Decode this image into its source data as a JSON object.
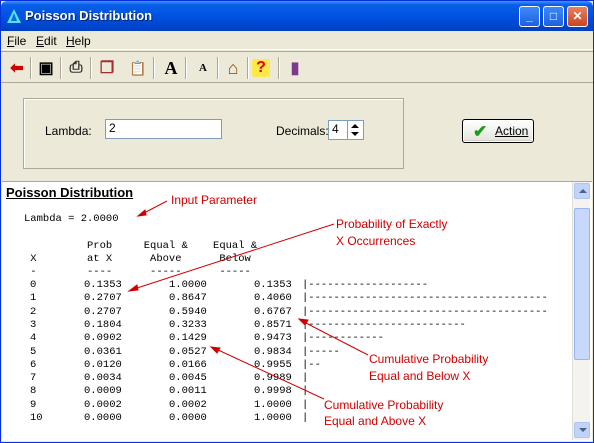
{
  "window": {
    "title": "Poisson Distribution",
    "minimize": "_",
    "maximize": "□",
    "close": "✕"
  },
  "menu": [
    {
      "label": "File",
      "accel": "F",
      "rest": "ile"
    },
    {
      "label": "Edit",
      "accel": "E",
      "rest": "dit"
    },
    {
      "label": "Help",
      "accel": "H",
      "rest": "elp"
    }
  ],
  "toolbar": {
    "buttons": [
      "back-icon",
      "save-icon",
      "print-icon",
      "copy-icon",
      "paste-icon",
      "font-larger-icon",
      "font-smaller-icon",
      "home-icon",
      "help-icon",
      "exit-icon"
    ],
    "glyphs": {
      "back": "⬅",
      "save": "▣",
      "print": "⎙",
      "copy": "❐",
      "paste": "📋",
      "font_larger": "A",
      "font_smaller": "A",
      "home": "⌂",
      "help": "?",
      "exit": "▮"
    }
  },
  "inputs": {
    "lambda_label": "Lambda:",
    "lambda_value": "2",
    "decimals_label": "Decimals:",
    "decimals_value": "4",
    "action_label": "Action"
  },
  "output": {
    "heading": "Poisson Distribution",
    "lambda_line": "Lambda = 2.0000",
    "header_line1": "          Prob     Equal &    Equal &",
    "header_line2": " X        at X      Above      Below",
    "header_line3": " -        ----      -----      -----",
    "rows": [
      {
        "x": "0",
        "prob": "0.1353",
        "above": "1.0000",
        "below": "0.1353",
        "bar": "|-------------------"
      },
      {
        "x": "1",
        "prob": "0.2707",
        "above": "0.8647",
        "below": "0.4060",
        "bar": "|--------------------------------------"
      },
      {
        "x": "2",
        "prob": "0.2707",
        "above": "0.5940",
        "below": "0.6767",
        "bar": "|--------------------------------------"
      },
      {
        "x": "3",
        "prob": "0.1804",
        "above": "0.3233",
        "below": "0.8571",
        "bar": "|-------------------------"
      },
      {
        "x": "4",
        "prob": "0.0902",
        "above": "0.1429",
        "below": "0.9473",
        "bar": "|------------"
      },
      {
        "x": "5",
        "prob": "0.0361",
        "above": "0.0527",
        "below": "0.9834",
        "bar": "|-----"
      },
      {
        "x": "6",
        "prob": "0.0120",
        "above": "0.0166",
        "below": "0.9955",
        "bar": "|--"
      },
      {
        "x": "7",
        "prob": "0.0034",
        "above": "0.0045",
        "below": "0.9989",
        "bar": "|"
      },
      {
        "x": "8",
        "prob": "0.0009",
        "above": "0.0011",
        "below": "0.9998",
        "bar": "|"
      },
      {
        "x": "9",
        "prob": "0.0002",
        "above": "0.0002",
        "below": "1.0000",
        "bar": "|"
      },
      {
        "x": "10",
        "prob": "0.0000",
        "above": "0.0000",
        "below": "1.0000",
        "bar": "|"
      }
    ]
  },
  "annotations": {
    "input_parameter": "Input Parameter",
    "prob_exactly_1": "Probability of Exactly",
    "prob_exactly_2": "X Occurrences",
    "cum_below_1": "Cumulative  Probability",
    "cum_below_2": "Equal and Below X",
    "cum_above_1": "Cumulative  Probability",
    "cum_above_2": "Equal and Above X",
    "color": "#d10000"
  }
}
